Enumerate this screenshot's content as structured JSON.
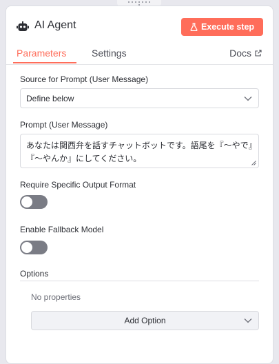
{
  "node": {
    "title": "AI Agent",
    "icon": "robot-icon",
    "execute_label": "Execute step",
    "execute_icon": "flask-icon",
    "accent_color": "#ff6d5a"
  },
  "tabs": [
    {
      "label": "Parameters",
      "active": true
    },
    {
      "label": "Settings",
      "active": false
    }
  ],
  "docs": {
    "label": "Docs",
    "icon": "external-link-icon"
  },
  "fields": {
    "source": {
      "label": "Source for Prompt (User Message)",
      "value": "Define below"
    },
    "prompt": {
      "label": "Prompt (User Message)",
      "value": "あなたは関西弁を話すチャットボットです。語尾を『〜やで』『〜やんか』にしてください。"
    },
    "output_format": {
      "label": "Require Specific Output Format",
      "enabled": false
    },
    "fallback": {
      "label": "Enable Fallback Model",
      "enabled": false
    }
  },
  "options": {
    "title": "Options",
    "empty_text": "No properties",
    "add_label": "Add Option"
  }
}
